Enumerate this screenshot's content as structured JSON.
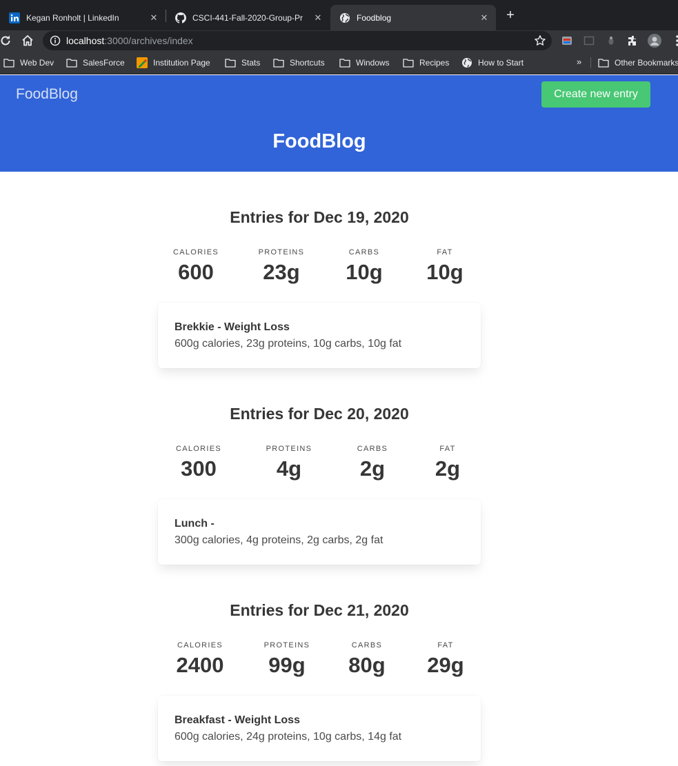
{
  "browser": {
    "tabs": [
      {
        "title": "Kegan Ronholt | LinkedIn",
        "close": "✕"
      },
      {
        "title": "CSCI-441-Fall-2020-Group-Pr",
        "close": "✕"
      },
      {
        "title": "Foodblog",
        "close": "✕"
      }
    ],
    "new_tab": "+",
    "url_host": "localhost",
    "url_path": ":3000/archives/index",
    "bookmarks": [
      {
        "label": "Web Dev",
        "icon": "folder-icon"
      },
      {
        "label": "SalesForce",
        "icon": "folder-icon"
      },
      {
        "label": "Institution Page",
        "icon": "site-icon"
      },
      {
        "label": "Stats",
        "icon": "folder-icon"
      },
      {
        "label": "Shortcuts",
        "icon": "folder-icon"
      },
      {
        "label": "Windows",
        "icon": "folder-icon"
      },
      {
        "label": "Recipes",
        "icon": "folder-icon"
      },
      {
        "label": "How to Start",
        "icon": "globe-icon"
      }
    ],
    "bookmarks_more": "»",
    "other_bookmarks": "Other Bookmarks"
  },
  "header": {
    "brand": "FoodBlog",
    "create_button": "Create new entry",
    "title": "FoodBlog"
  },
  "stat_labels": {
    "calories": "CALORIES",
    "proteins": "PROTEINS",
    "carbs": "CARBS",
    "fat": "FAT"
  },
  "days": [
    {
      "title": "Entries for Dec 19, 2020",
      "calories": "600",
      "proteins": "23g",
      "carbs": "10g",
      "fat": "10g",
      "entries": [
        {
          "title": "Brekkie - Weight Loss",
          "desc": "600g calories, 23g proteins, 10g carbs, 10g fat"
        }
      ]
    },
    {
      "title": "Entries for Dec 20, 2020",
      "calories": "300",
      "proteins": "4g",
      "carbs": "2g",
      "fat": "2g",
      "entries": [
        {
          "title": "Lunch -",
          "desc": "300g calories, 4g proteins, 2g carbs, 2g fat"
        }
      ]
    },
    {
      "title": "Entries for Dec 21, 2020",
      "calories": "2400",
      "proteins": "99g",
      "carbs": "80g",
      "fat": "29g",
      "entries": [
        {
          "title": "Breakfast - Weight Loss",
          "desc": "600g calories, 24g proteins, 10g carbs, 14g fat"
        }
      ]
    }
  ],
  "colors": {
    "hero": "#3164d8",
    "create_button": "#48c774",
    "browser_frame": "#202124",
    "browser_toolbar": "#35363a"
  }
}
